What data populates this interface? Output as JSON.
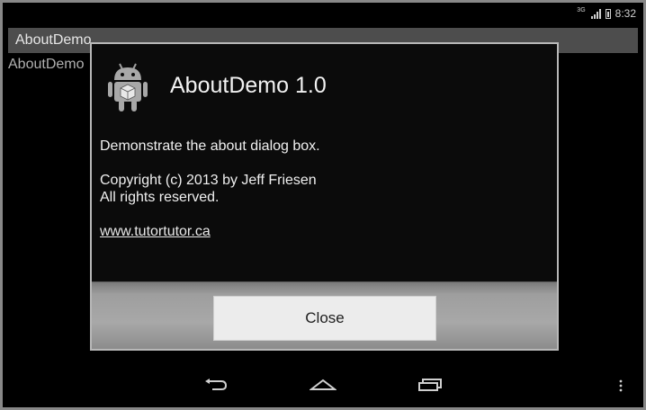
{
  "statusbar": {
    "network": "3G",
    "time": "8:32"
  },
  "actionbar": {
    "title": "AboutDemo"
  },
  "content": {
    "text": "AboutDemo"
  },
  "dialog": {
    "title": "AboutDemo 1.0",
    "description": "Demonstrate the about dialog box.",
    "copyright_line1": "Copyright (c) 2013 by Jeff Friesen",
    "copyright_line2": "All rights reserved.",
    "link": "www.tutortutor.ca",
    "close_label": "Close"
  },
  "icons": [
    "android-robot-icon",
    "signal-icon",
    "battery-icon",
    "back-icon",
    "home-icon",
    "recent-apps-icon",
    "overflow-menu-icon"
  ]
}
